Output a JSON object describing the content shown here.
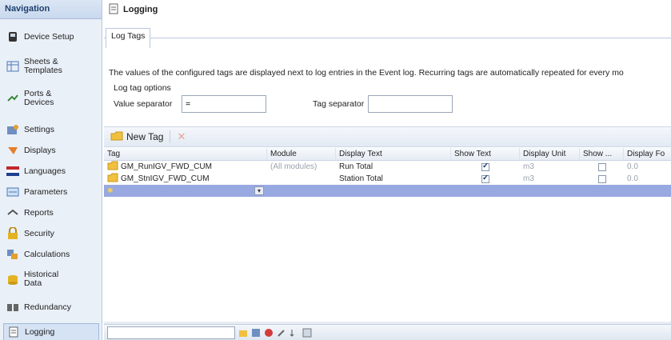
{
  "navigation": {
    "header": "Navigation",
    "items": [
      {
        "label": "Device Setup",
        "icon": "device-setup-icon"
      },
      {
        "label": "Sheets &\nTemplates",
        "icon": "sheets-icon"
      },
      {
        "label": "Ports &\nDevices",
        "icon": "ports-icon"
      },
      {
        "label": "Settings",
        "icon": "settings-icon"
      },
      {
        "label": "Displays",
        "icon": "displays-icon"
      },
      {
        "label": "Languages",
        "icon": "languages-icon"
      },
      {
        "label": "Parameters",
        "icon": "parameters-icon"
      },
      {
        "label": "Reports",
        "icon": "reports-icon"
      },
      {
        "label": "Security",
        "icon": "lock-icon"
      },
      {
        "label": "Calculations",
        "icon": "calculations-icon"
      },
      {
        "label": "Historical\nData",
        "icon": "historical-data-icon"
      },
      {
        "label": "Redundancy",
        "icon": "redundancy-icon"
      },
      {
        "label": "Logging",
        "icon": "logging-icon"
      }
    ],
    "selected": "Logging"
  },
  "page": {
    "title": "Logging",
    "tab": "Log Tags",
    "description": "The values of the configured tags are displayed next to log entries in the Event log. Recurring tags are automatically repeated for every mo",
    "options_label": "Log tag options",
    "value_separator_label": "Value separator",
    "value_separator_value": "=",
    "tag_separator_label": "Tag separator",
    "tag_separator_value": ""
  },
  "toolbar": {
    "new_tag_label": "New Tag"
  },
  "grid": {
    "columns": [
      "Tag",
      "Module",
      "Display Text",
      "Show Text",
      "Display Unit",
      "Show ...",
      "Display Fo"
    ],
    "rows": [
      {
        "tag": "GM_RunIGV_FWD_CUM",
        "module": "(All modules)",
        "display_text": "Run Total",
        "show_text": true,
        "display_unit": "m3",
        "show_unit": false,
        "display_format": "0.0"
      },
      {
        "tag": "GM_StnIGV_FWD_CUM",
        "module": "",
        "display_text": "Station Total",
        "show_text": true,
        "display_unit": "m3",
        "show_unit": false,
        "display_format": "0.0"
      }
    ]
  }
}
